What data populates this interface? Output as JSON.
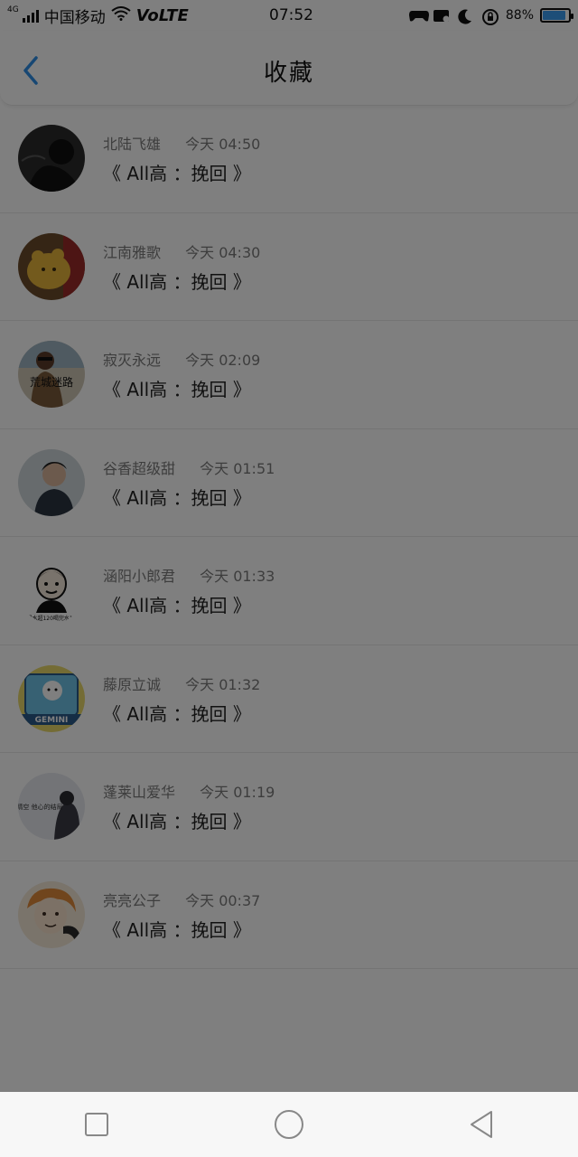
{
  "status_bar": {
    "network": "4G",
    "carrier": "中国移动",
    "volte": "VoLTE",
    "time": "07:52",
    "battery": "88%",
    "battery_level": 0.88,
    "battery_color": "#3a9df0"
  },
  "header": {
    "title": "收藏"
  },
  "favorites": [
    {
      "name": "北陆飞雄",
      "time": "今天 04:50",
      "message": "《 All高 ：挽回 》",
      "avatar": "dark-silhouette"
    },
    {
      "name": "江南雅歌",
      "time": "今天 04:30",
      "message": "《 All高 ：挽回 》",
      "avatar": "yellow-bear"
    },
    {
      "name": "寂灭永远",
      "time": "今天 02:09",
      "message": "《 All高 ：挽回 》",
      "avatar": "boy-with-caption",
      "avatar_caption": "荒城迷路"
    },
    {
      "name": "谷香超级甜",
      "time": "今天 01:51",
      "message": "《 All高 ：挽回 》",
      "avatar": "boy-portrait"
    },
    {
      "name": "涵阳小郎君",
      "time": "今天 01:33",
      "message": "《 All高 ：挽回 》",
      "avatar": "cartoon-man",
      "avatar_caption": "喝水超120喝完水12"
    },
    {
      "name": "藤原立诚",
      "time": "今天 01:32",
      "message": "《 All高 ：挽回 》",
      "avatar": "gemini-box",
      "avatar_caption": "GEMINI"
    },
    {
      "name": "蓬莱山爱华",
      "time": "今天 01:19",
      "message": "《 All高 ：挽回 》",
      "avatar": "girl-sketch",
      "avatar_caption": "晴空 他心的结局"
    },
    {
      "name": "亮亮公子",
      "time": "今天 00:37",
      "message": "《 All高 ：挽回 》",
      "avatar": "anime-boy"
    }
  ],
  "nav": {
    "recent_label": "recent-apps",
    "home_label": "home",
    "back_label": "back"
  },
  "colors": {
    "accent": "#2f8ee6",
    "overlay": "rgba(0,0,0,0.5)"
  }
}
